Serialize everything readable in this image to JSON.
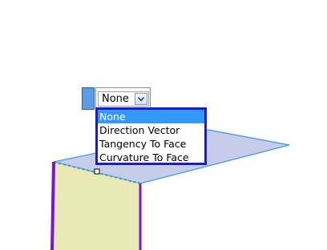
{
  "combo": {
    "value": "None",
    "options": [
      {
        "label": "None",
        "selected": true
      },
      {
        "label": "Direction Vector",
        "selected": false
      },
      {
        "label": "Tangency To Face",
        "selected": false
      },
      {
        "label": "Curvature To Face",
        "selected": false
      }
    ]
  },
  "colors": {
    "surface_fill": "#c8cceb",
    "surface_edge": "#3a9bd6",
    "face_fill": "#e9e9b6",
    "face_edge": "#7a13e0",
    "dropdown_border": "#1a1ad0",
    "selection": "#3399ff",
    "handle": "#5b9be8"
  },
  "icons": {
    "combo_arrow": "chevron-down-icon"
  }
}
